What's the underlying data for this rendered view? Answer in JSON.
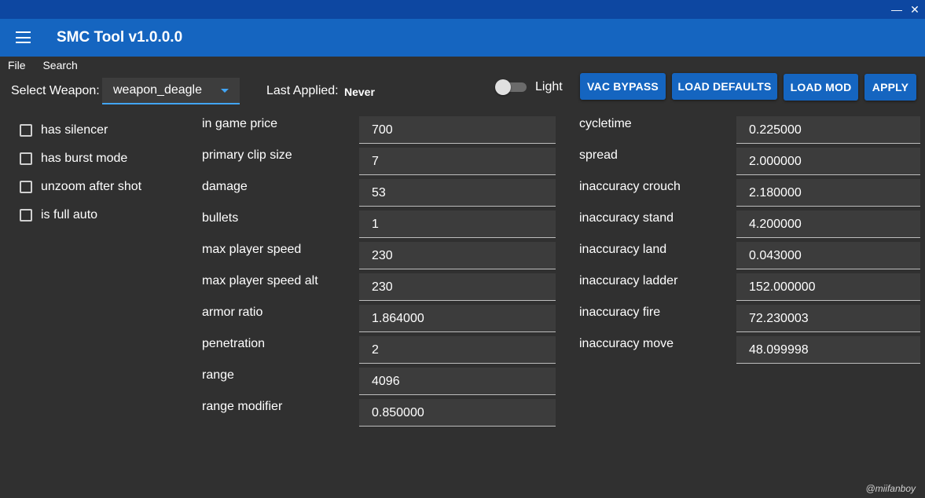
{
  "window": {
    "minimize_glyph": "—",
    "close_glyph": "✕"
  },
  "app": {
    "title": "SMC Tool v1.0.0.0",
    "credit": "@miifanboy"
  },
  "menu": [
    "File",
    "Search"
  ],
  "toolbar": {
    "select_weapon_label": "Select Weapon:",
    "weapon_value": "weapon_deagle",
    "last_applied_label": "Last Applied:",
    "last_applied_value": "Never",
    "theme_label": "Light",
    "buttons": {
      "vac_bypass": "VAC BYPASS",
      "load_defaults": "LOAD DEFAULTS",
      "load_mod": "LOAD MOD",
      "apply": "APPLY"
    }
  },
  "checkboxes": [
    {
      "label": "has silencer",
      "checked": false
    },
    {
      "label": "has burst mode",
      "checked": false
    },
    {
      "label": "unzoom after shot",
      "checked": false
    },
    {
      "label": "is full auto",
      "checked": false
    }
  ],
  "fields_left": [
    {
      "label": "in game price",
      "value": "700"
    },
    {
      "label": "primary clip size",
      "value": "7"
    },
    {
      "label": "damage",
      "value": "53"
    },
    {
      "label": "bullets",
      "value": "1"
    },
    {
      "label": "max player speed",
      "value": "230"
    },
    {
      "label": "max player speed alt",
      "value": "230"
    },
    {
      "label": "armor ratio",
      "value": "1.864000"
    },
    {
      "label": "penetration",
      "value": "2"
    },
    {
      "label": "range",
      "value": "4096"
    },
    {
      "label": "range modifier",
      "value": "0.850000"
    }
  ],
  "fields_right": [
    {
      "label": "cycletime",
      "value": "0.225000"
    },
    {
      "label": "spread",
      "value": "2.000000"
    },
    {
      "label": "inaccuracy crouch",
      "value": "2.180000"
    },
    {
      "label": "inaccuracy stand",
      "value": "4.200000"
    },
    {
      "label": "inaccuracy land",
      "value": "0.043000"
    },
    {
      "label": "inaccuracy ladder",
      "value": "152.000000"
    },
    {
      "label": "inaccuracy fire",
      "value": "72.230003"
    },
    {
      "label": "inaccuracy move",
      "value": "48.099998"
    }
  ],
  "colors": {
    "background": "#303030",
    "header": "#1565c0",
    "titlebar": "#0d47a1",
    "accent": "#42a5f5"
  }
}
